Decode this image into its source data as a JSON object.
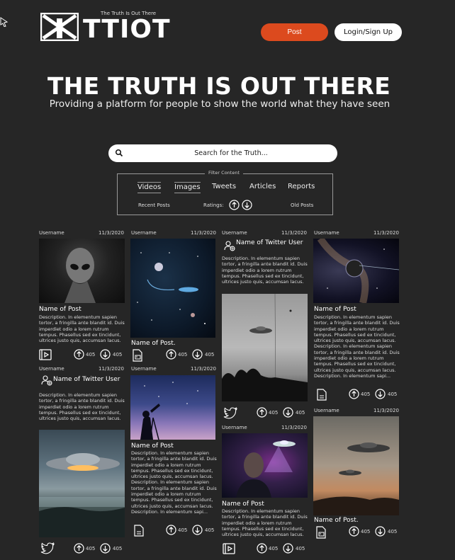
{
  "header": {
    "tagline": "The Truth Is Out There",
    "brand": "TTIOT",
    "post_label": "Post",
    "login_label": "Login/Sign Up"
  },
  "hero": {
    "title": "THE TRUTH IS OUT THERE",
    "subtitle": "Providing a platform for people to show the world what they have seen"
  },
  "search": {
    "placeholder": "Search for the Truth..."
  },
  "filter": {
    "legend": "Filter Content",
    "tabs": [
      "Videos",
      "Images",
      "Tweets",
      "Articles",
      "Reports"
    ],
    "recent": "Recent Posts",
    "ratings": "Ratings:",
    "old": "Old Posts"
  },
  "posts": {
    "username": "Username",
    "date": "11/3/2020",
    "post_name": "Name of Post",
    "post_name_dot": "Name of Post.",
    "twitter_name": "Name of Twitter User",
    "count": "405",
    "desc_short": "Description. In elementum sapien tortor, a fringilla ante blandit id. Duis imperdiet odio a lorem rutrum tempus. Phasellus sed ex tincidunt, ultrices justo quis, accumsan lacus.",
    "desc_long": "Description. In elementum sapien tortor, a fringilla ante blandit id. Duis imperdiet odio a lorem rutrum tempus. Phasellus sed ex tincidunt, ultrices justo quis, accumsan lacus. Description. In elementum sapien tortor, a fringilla ante blandit id. Duis imperdiet odio a lorem rutrum tempus. Phasellus sed ex tincidunt, ultrices justo quis, accumsan lacus. Description. In elementum sapi...",
    "desc_long2": "Description. In elementum sapien tortor, a fringilla ante blandit id. Duis imperdiet odio a lorem rutrum tempus. Phasellus sed ex tincidunt, ultrices justo quis, accumsan lacus. Description. In elementum sapien tortor, a fringilla ante blandit id. Duis imperdiet odio a lorem rutrum tempus. Phasellus sed ex tincidunt, ultrices justo quis, accumsan lacus. Description. In elementum sapi...",
    "colors": {
      "accent": "#dc4a1e",
      "background": "#262626"
    }
  }
}
